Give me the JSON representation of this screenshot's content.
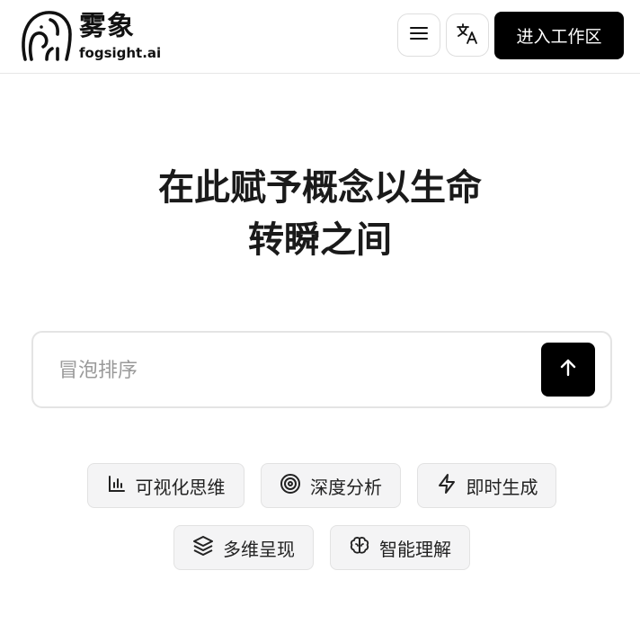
{
  "header": {
    "brand_name": "雾象",
    "brand_domain": "fogsight.ai",
    "logo_icon": "elephant-icon",
    "menu_icon": "hamburger-icon",
    "language_icon": "translate-icon",
    "enter_button_label": "进入工作区"
  },
  "hero": {
    "line1": "在此赋予概念以生命",
    "line2": "转瞬之间"
  },
  "search": {
    "placeholder": "冒泡排序",
    "value": "",
    "submit_icon": "arrow-up-icon"
  },
  "features": [
    {
      "label": "可视化思维",
      "icon": "bar-chart-icon"
    },
    {
      "label": "深度分析",
      "icon": "target-icon"
    },
    {
      "label": "即时生成",
      "icon": "lightning-icon"
    },
    {
      "label": "多维呈现",
      "icon": "layers-icon"
    },
    {
      "label": "智能理解",
      "icon": "brain-icon"
    }
  ],
  "colors": {
    "primary": "#000000",
    "chip_bg": "#f4f4f5",
    "border": "#e4e4e4",
    "placeholder": "#9a9a9a"
  }
}
